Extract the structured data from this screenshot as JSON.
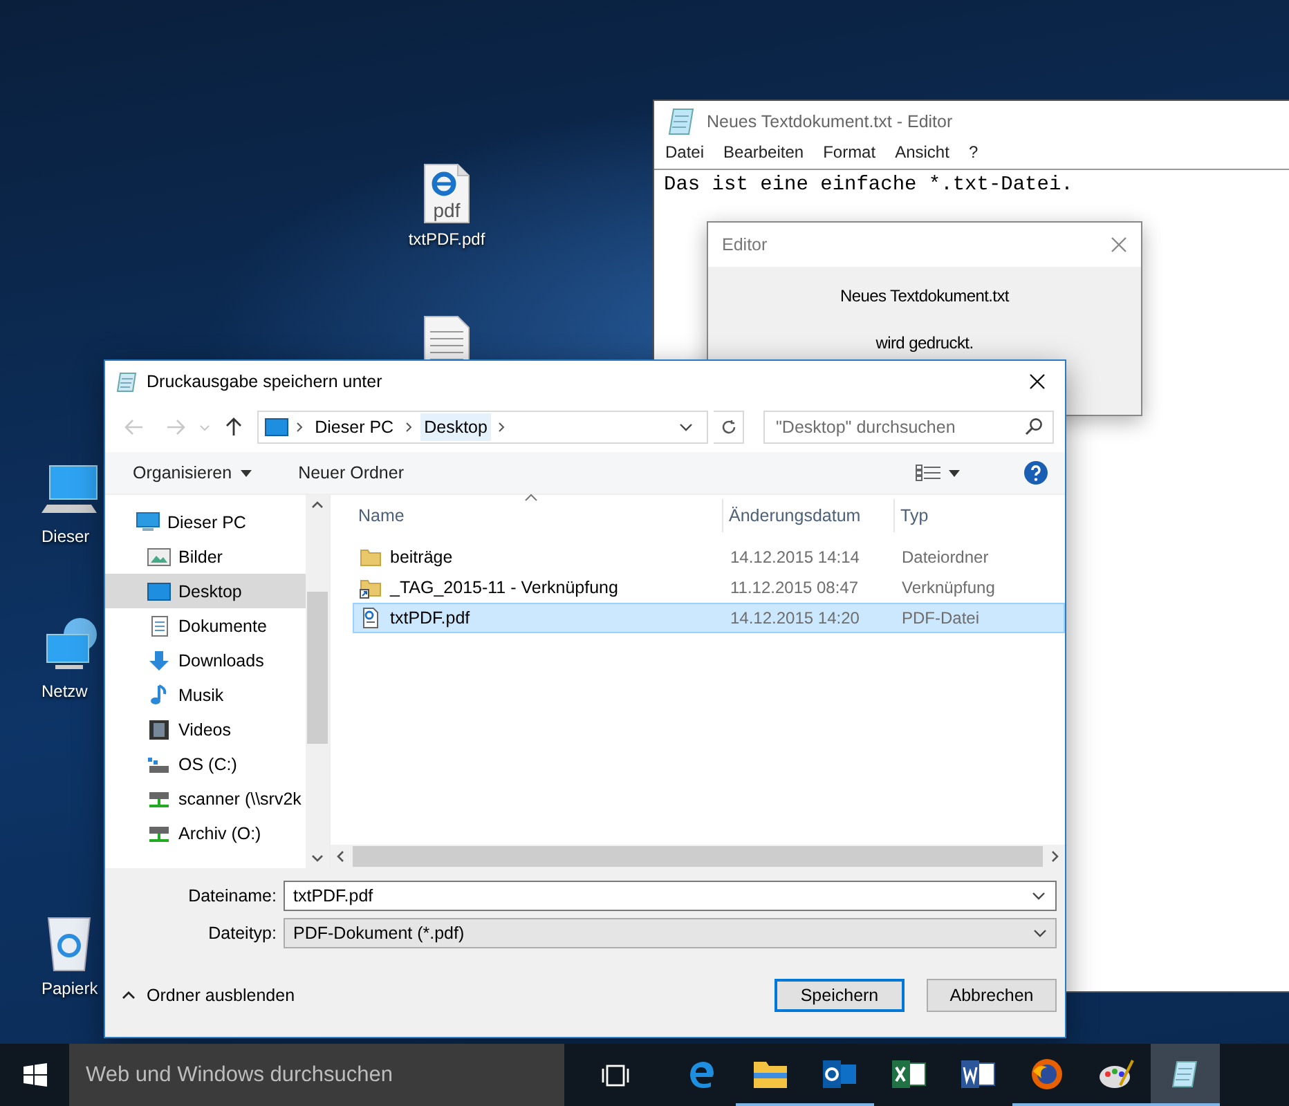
{
  "desktop_icons": [
    {
      "kind": "pdf",
      "label": "txtPDF.pdf",
      "badge": "pdf"
    },
    {
      "kind": "text"
    },
    {
      "kind": "pc",
      "label": "Dieser"
    },
    {
      "kind": "network",
      "label": "Netzw"
    },
    {
      "kind": "recycle",
      "label": "Papierk"
    }
  ],
  "notepad": {
    "title": "Neues Textdokument.txt - Editor",
    "menu": [
      "Datei",
      "Bearbeiten",
      "Format",
      "Ansicht",
      "?"
    ],
    "content": "Das ist eine einfache *.txt-Datei."
  },
  "print_dialog": {
    "title": "Editor",
    "lines": [
      "Neues Textdokument.txt",
      "wird gedruckt."
    ]
  },
  "save_dialog": {
    "title": "Druckausgabe speichern unter",
    "breadcrumb": [
      {
        "label": "Dieser PC",
        "selected": false
      },
      {
        "label": "Desktop",
        "selected": true
      }
    ],
    "search": {
      "placeholder": "\"Desktop\" durchsuchen"
    },
    "toolbar": {
      "organize": "Organisieren",
      "new_folder": "Neuer Ordner"
    },
    "nav": [
      {
        "label": "Dieser PC",
        "kind": "pc",
        "selected": false,
        "children": [
          {
            "label": "Bilder",
            "kind": "pictures",
            "selected": false
          },
          {
            "label": "Desktop",
            "kind": "desktop",
            "selected": true
          },
          {
            "label": "Dokumente",
            "kind": "documents",
            "selected": false
          },
          {
            "label": "Downloads",
            "kind": "downloads",
            "selected": false
          },
          {
            "label": "Musik",
            "kind": "music",
            "selected": false
          },
          {
            "label": "Videos",
            "kind": "videos",
            "selected": false
          },
          {
            "label": "OS (C:)",
            "kind": "drive",
            "selected": false
          },
          {
            "label": "scanner (\\\\srv2k",
            "kind": "netdrive",
            "selected": false
          },
          {
            "label": "Archiv (O:)",
            "kind": "netdrive",
            "selected": false
          }
        ]
      }
    ],
    "columns": [
      "Name",
      "Änderungsdatum",
      "Typ"
    ],
    "files": [
      {
        "name": "beiträge",
        "date": "14.12.2015 14:14",
        "type": "Dateiordner",
        "kind": "folder",
        "selected": false
      },
      {
        "name": "_TAG_2015-11 - Verknüpfung",
        "date": "11.12.2015 08:47",
        "type": "Verknüpfung",
        "kind": "shortcut",
        "selected": false
      },
      {
        "name": "txtPDF.pdf",
        "date": "14.12.2015 14:20",
        "type": "PDF-Datei",
        "kind": "pdf",
        "selected": true
      }
    ],
    "filename": {
      "label": "Dateiname:",
      "value": "txtPDF.pdf"
    },
    "filetype": {
      "label": "Dateityp:",
      "value": "PDF-Dokument (*.pdf)"
    },
    "hide_folders": "Ordner ausblenden",
    "buttons": [
      {
        "label": "Speichern",
        "default": true
      },
      {
        "label": "Abbrechen",
        "default": false
      }
    ]
  },
  "taskbar": {
    "search": {
      "placeholder": "Web und Windows durchsuchen"
    },
    "apps": [
      {
        "kind": "edge",
        "running": false,
        "active": false
      },
      {
        "kind": "explorer",
        "running": true,
        "active": false
      },
      {
        "kind": "outlook",
        "running": true,
        "active": false
      },
      {
        "kind": "excel",
        "running": false,
        "active": false
      },
      {
        "kind": "word",
        "running": false,
        "active": false
      },
      {
        "kind": "firefox",
        "running": true,
        "active": false
      },
      {
        "kind": "paint",
        "running": true,
        "active": false
      },
      {
        "kind": "notepad",
        "running": true,
        "active": true
      }
    ]
  }
}
